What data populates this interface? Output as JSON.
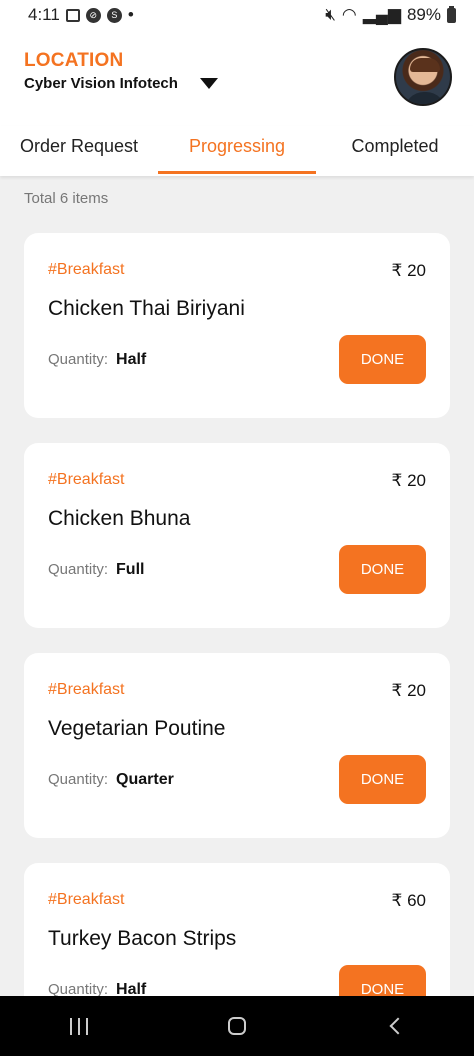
{
  "status_bar": {
    "time": "4:11",
    "battery": "89%",
    "dot": "•"
  },
  "header": {
    "location_label": "LOCATION",
    "location_name": "Cyber Vision Infotech"
  },
  "tabs": [
    {
      "label": "Order Request",
      "active": false
    },
    {
      "label": "Progressing",
      "active": true
    },
    {
      "label": "Completed",
      "active": false
    }
  ],
  "summary": {
    "total_text": "Total 6 items"
  },
  "labels": {
    "quantity": "Quantity:",
    "done": "DONE"
  },
  "items": [
    {
      "tag": "#Breakfast",
      "price": "₹ 20",
      "name": "Chicken Thai Biriyani",
      "quantity": "Half"
    },
    {
      "tag": "#Breakfast",
      "price": "₹ 20",
      "name": "Chicken Bhuna",
      "quantity": "Full"
    },
    {
      "tag": "#Breakfast",
      "price": "₹ 20",
      "name": "Vegetarian Poutine",
      "quantity": "Quarter"
    },
    {
      "tag": "#Breakfast",
      "price": "₹ 60",
      "name": "Turkey Bacon Strips",
      "quantity": "Half"
    }
  ],
  "colors": {
    "accent": "#f47321",
    "background": "#f0f0f0",
    "card": "#ffffff"
  }
}
